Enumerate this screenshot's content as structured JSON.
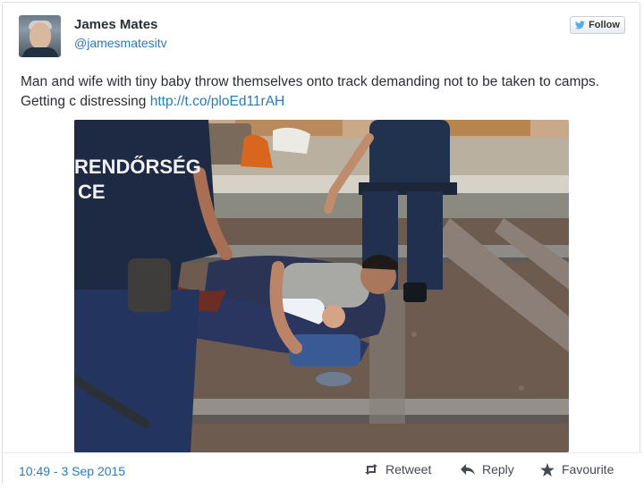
{
  "author": {
    "name": "James Mates",
    "handle": "@jamesmatesitv"
  },
  "follow_button": {
    "label": "Follow"
  },
  "tweet": {
    "text": "Man and wife with tiny baby throw themselves onto track demanding not to be taken to camps. Getting c distressing ",
    "link": "http://t.co/ploEd11rAH"
  },
  "photo": {
    "vest_text_line1": "RENDŐRSÉG",
    "vest_text_line2": "CE"
  },
  "footer": {
    "timestamp": "10:49 - 3 Sep 2015",
    "retweet_label": "Retweet",
    "reply_label": "Reply",
    "favourite_label": "Favourite"
  },
  "colors": {
    "link": "#2b7bb9",
    "text": "#292f33",
    "action_text": "#434a50"
  },
  "icons": {
    "follow": "twitter-bird-icon",
    "retweet": "retweet-icon",
    "reply": "reply-icon",
    "favourite": "star-icon"
  }
}
